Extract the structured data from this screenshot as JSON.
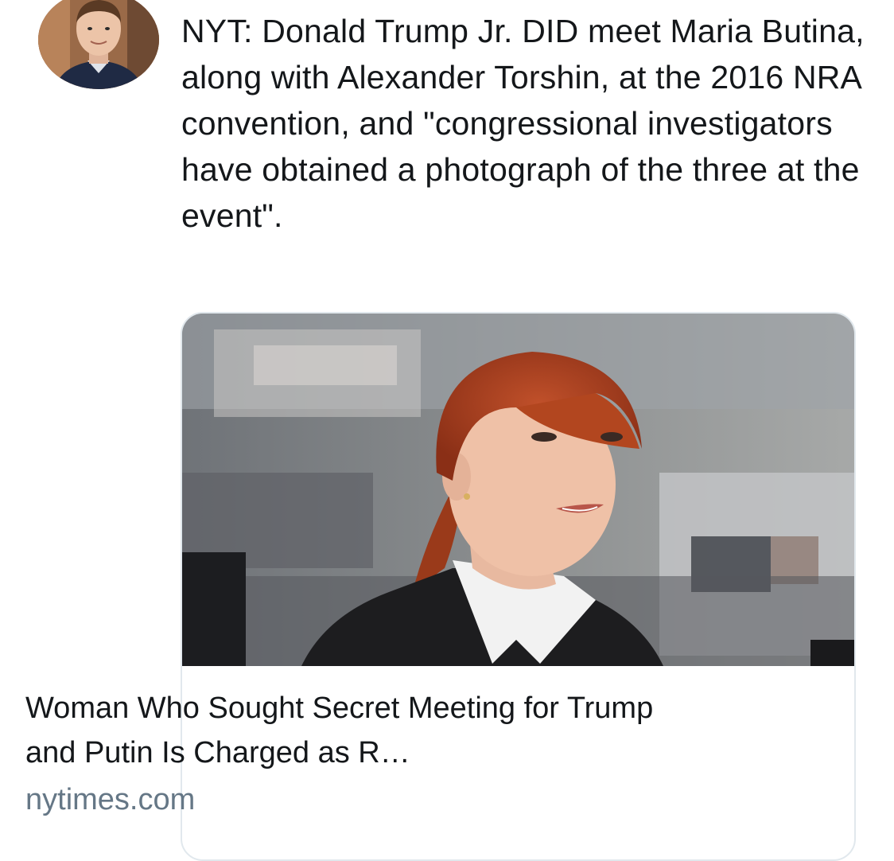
{
  "tweet": {
    "text": "NYT: Donald Trump Jr. DID meet Maria Butina, along with Alexander Torshin, at the 2016 NRA convention, and \"congressional investigators have obtained a photograph of the three at the event\".",
    "avatar_icon": "user-avatar"
  },
  "card": {
    "title": "Woman Who Sought Secret Meeting for Trump and Putin Is Charged as R…",
    "domain": "nytimes.com",
    "image_icon": "article-photo"
  },
  "colors": {
    "text": "#14171a",
    "secondary_text": "#657786",
    "card_border": "#e1e8ed"
  }
}
